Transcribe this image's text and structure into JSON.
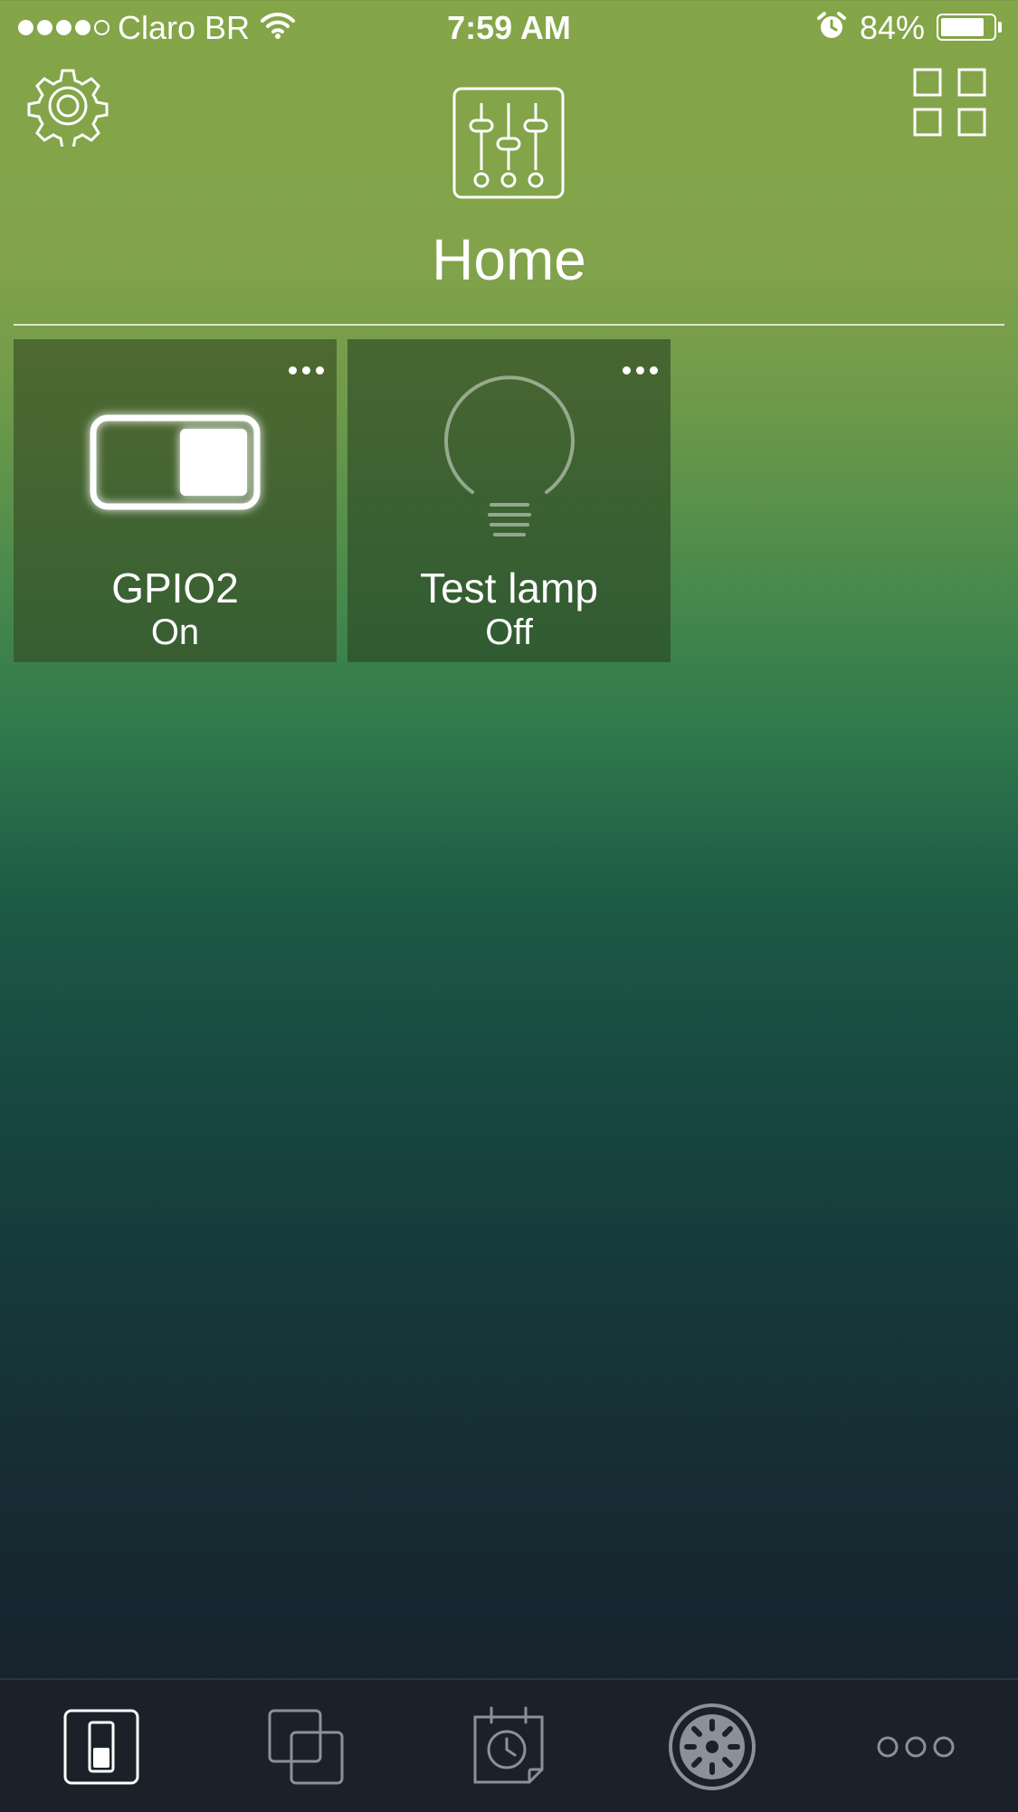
{
  "status_bar": {
    "carrier": "Claro BR",
    "time": "7:59 AM",
    "battery_percent": "84%",
    "battery_level": 0.84,
    "signal_bars_filled": 4,
    "signal_bars_total": 5,
    "icons": [
      "wifi-icon",
      "alarm-clock-icon",
      "battery-icon"
    ]
  },
  "header": {
    "title": "Home",
    "left_icon": "gear-icon",
    "center_icon": "mixer-sliders-icon",
    "right_icon": "grid-view-icon"
  },
  "tiles": [
    {
      "name": "GPIO2",
      "state": "On",
      "icon": "toggle-switch-icon"
    },
    {
      "name": "Test lamp",
      "state": "Off",
      "icon": "light-bulb-icon"
    }
  ],
  "tab_bar": {
    "tabs": [
      {
        "icon": "switch-device-icon",
        "active": true
      },
      {
        "icon": "groups-icon",
        "active": false
      },
      {
        "icon": "schedule-icon",
        "active": false
      },
      {
        "icon": "wheel-icon",
        "active": false
      },
      {
        "icon": "more-icon",
        "active": false
      }
    ]
  },
  "colors": {
    "gradient_top": "#84a548",
    "gradient_mid": "#307a4c",
    "gradient_bottom": "#172230",
    "tab_bar_bg": "#1b2129",
    "text": "#ffffff"
  }
}
